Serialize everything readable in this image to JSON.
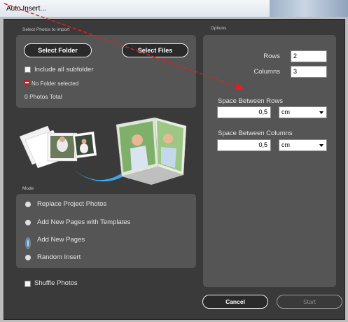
{
  "window": {
    "title": "Auto Insert..."
  },
  "import": {
    "section_label": "Select Photos to import",
    "select_folder": "Select Folder",
    "select_files": "Select Files",
    "include_subfolder": "Include all subfolder",
    "no_folder": "No Folder selected",
    "photos_total": "0 Photos Total"
  },
  "mode": {
    "section_label": "Mode",
    "options": [
      "Replace Project Photos",
      "Add New Pages with Templates",
      "Add New Pages",
      "Random Insert"
    ],
    "selected": "Add New Pages"
  },
  "shuffle_label": "Shuffle Photos",
  "options": {
    "section_label": "Options",
    "rows_label": "Rows",
    "rows_value": "2",
    "columns_label": "Columns",
    "columns_value": "3",
    "space_rows_label": "Space Between Rows",
    "space_rows_value": "0,5",
    "space_rows_unit": "cm",
    "space_cols_label": "Space Between Columns",
    "space_cols_value": "0,5",
    "space_cols_unit": "cm"
  },
  "footer": {
    "cancel": "Cancel",
    "start": "Start"
  },
  "colors": {
    "accent_blue": "#3aa6e8",
    "arrow_red": "#e02020",
    "no_folder_red": "#cc1e1e"
  }
}
